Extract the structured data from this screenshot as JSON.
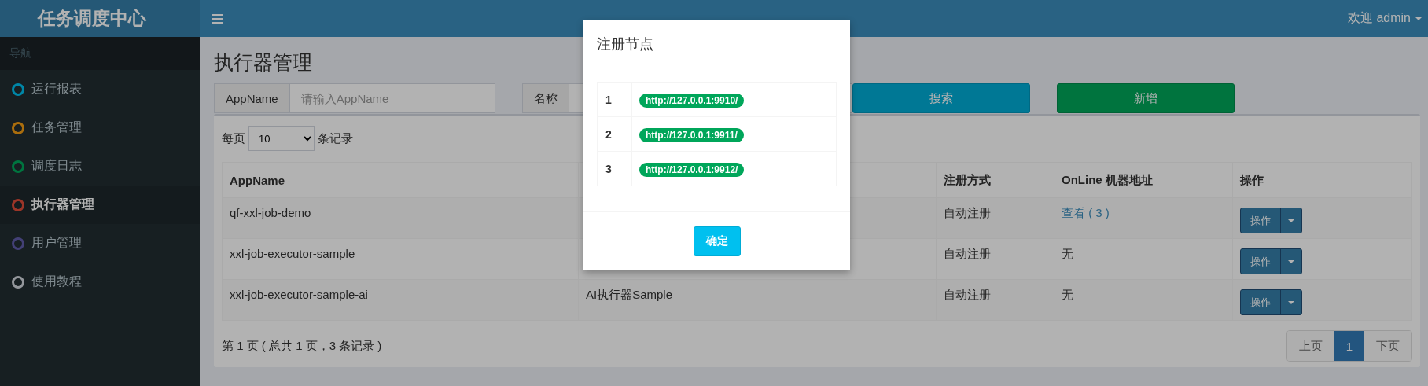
{
  "brand": "任务调度中心",
  "header": {
    "user": "欢迎 admin"
  },
  "sidebar": {
    "heading": "导航",
    "items": [
      {
        "label": "运行报表",
        "color": "#0086a7",
        "selected": false
      },
      {
        "label": "任务管理",
        "color": "#aa6d0d",
        "selected": false
      },
      {
        "label": "调度日志",
        "color": "#00743f",
        "selected": false
      },
      {
        "label": "执行器管理",
        "color": "#9b3528",
        "selected": true
      },
      {
        "label": "用户管理",
        "color": "#434076",
        "selected": false
      },
      {
        "label": "使用教程",
        "color": "#93969b",
        "selected": false
      }
    ]
  },
  "page": {
    "title": "执行器管理",
    "filters": [
      {
        "label": "AppName",
        "placeholder": "请输入AppName"
      },
      {
        "label": "名称"
      }
    ],
    "buttons": [
      {
        "label": "搜索",
        "kind": "search"
      },
      {
        "label": "新增",
        "kind": "add"
      }
    ],
    "page_size": {
      "prefix": "每页",
      "value": "10",
      "suffix": "条记录"
    },
    "table": {
      "columns": [
        "AppName",
        "注册方式",
        "OnLine 机器地址",
        "操作"
      ],
      "rows": [
        {
          "app_name": "qf-xxl-job-demo",
          "registration": "自动注册",
          "online": {
            "kind": "link",
            "text": "查看 ( 3 )"
          },
          "action": "操作"
        },
        {
          "app_name": "xxl-job-executor-sample",
          "registration": "自动注册",
          "online": {
            "kind": "text",
            "text": "无"
          },
          "action": "操作"
        },
        {
          "app_name": "xxl-job-executor-sample-ai",
          "column_2": "AI执行器Sample",
          "registration": "自动注册",
          "online": {
            "kind": "text",
            "text": "无"
          },
          "action": "操作"
        }
      ]
    },
    "summary": "第 1 页 ( 总共 1 页，3 条记录 )",
    "pagination": {
      "prev": "上页",
      "pages": [
        {
          "label": "1",
          "selected": true
        }
      ],
      "next": "下页"
    }
  },
  "modal": {
    "title": "注册节点",
    "nodes": [
      {
        "index": "1",
        "address": "http://127.0.0.1:9910/"
      },
      {
        "index": "2",
        "address": "http://127.0.0.1:9911/"
      },
      {
        "index": "3",
        "address": "http://127.0.0.1:9912/"
      }
    ],
    "confirm": "确定"
  }
}
